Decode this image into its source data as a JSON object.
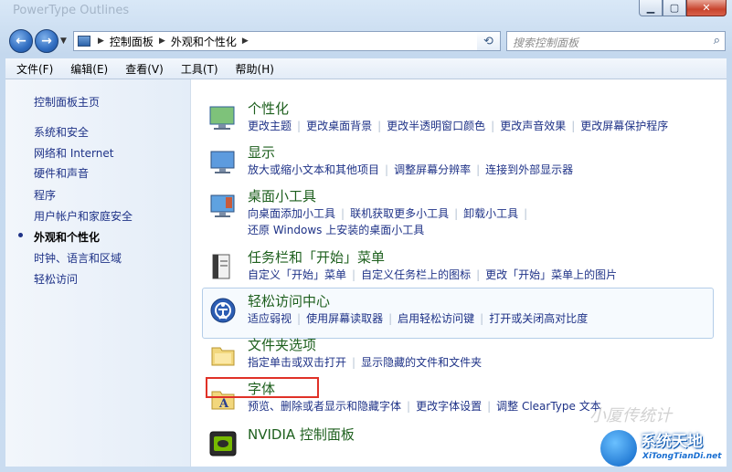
{
  "window": {
    "title": "PowerType Outlines",
    "minimize_icon": "minimize-icon",
    "maximize_icon": "maximize-icon",
    "close_icon": "close-icon"
  },
  "nav": {
    "back_icon": "back-arrow-icon",
    "forward_icon": "forward-arrow-icon",
    "breadcrumb": [
      "控制面板",
      "外观和个性化"
    ],
    "search_placeholder": "搜索控制面板"
  },
  "menu": [
    "文件(F)",
    "编辑(E)",
    "查看(V)",
    "工具(T)",
    "帮助(H)"
  ],
  "sidebar": {
    "home": "控制面板主页",
    "items": [
      "系统和安全",
      "网络和 Internet",
      "硬件和声音",
      "程序",
      "用户帐户和家庭安全",
      "外观和个性化",
      "时钟、语言和区域",
      "轻松访问"
    ],
    "current_index": 5
  },
  "categories": [
    {
      "title": "个性化",
      "links": [
        "更改主题",
        "更改桌面背景",
        "更改半透明窗口颜色",
        "更改声音效果",
        "更改屏幕保护程序"
      ],
      "links2": []
    },
    {
      "title": "显示",
      "links": [
        "放大或缩小文本和其他项目",
        "调整屏幕分辨率",
        "连接到外部显示器"
      ],
      "links2": []
    },
    {
      "title": "桌面小工具",
      "links": [
        "向桌面添加小工具",
        "联机获取更多小工具",
        "卸载小工具"
      ],
      "links2": [
        "还原 Windows 上安装的桌面小工具"
      ]
    },
    {
      "title": "任务栏和「开始」菜单",
      "links": [
        "自定义「开始」菜单",
        "自定义任务栏上的图标",
        "更改「开始」菜单上的图片"
      ],
      "links2": []
    },
    {
      "title": "轻松访问中心",
      "links": [
        "适应弱视",
        "使用屏幕读取器",
        "启用轻松访问键",
        "打开或关闭高对比度"
      ],
      "links2": []
    },
    {
      "title": "文件夹选项",
      "links": [
        "指定单击或双击打开",
        "显示隐藏的文件和文件夹"
      ],
      "links2": []
    },
    {
      "title": "字体",
      "links": [
        "预览、删除或者显示和隐藏字体",
        "更改字体设置",
        "调整 ClearType 文本"
      ],
      "links2": []
    },
    {
      "title": "NVIDIA 控制面板",
      "links": [],
      "links2": []
    }
  ],
  "watermark": {
    "main": "系统天地",
    "sub": "XiTongTianDi.net",
    "faint": "小厦传统计"
  }
}
